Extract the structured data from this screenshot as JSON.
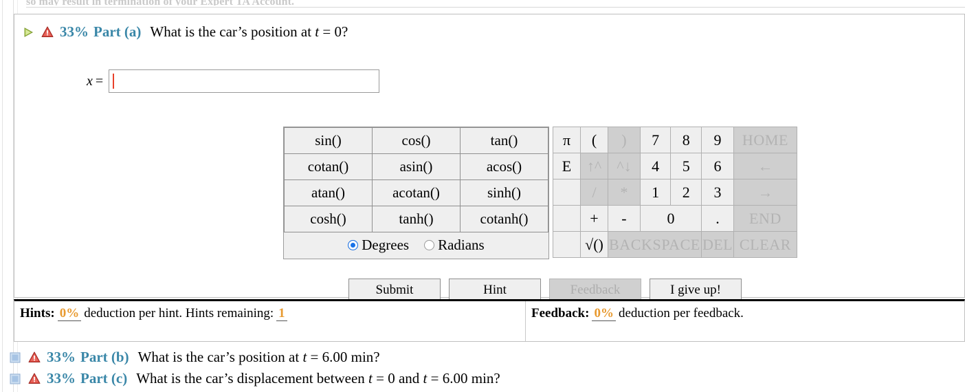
{
  "top_clipped_text": "so may result in termination of your Expert TA Account.",
  "part_a": {
    "icons": {
      "expand": "play-triangle-icon",
      "warning": "warning-triangle-icon"
    },
    "percent": "33%",
    "part_label": "Part (a)",
    "question_prefix": "What is the car’s position at ",
    "question_var": "t",
    "question_suffix": " = 0?",
    "answer": {
      "variable": "x",
      "equals": "=",
      "value": "",
      "placeholder": ""
    }
  },
  "calculator": {
    "functions": [
      [
        "sin()",
        "cos()",
        "tan()"
      ],
      [
        "cotan()",
        "asin()",
        "acos()"
      ],
      [
        "atan()",
        "acotan()",
        "sinh()"
      ],
      [
        "cosh()",
        "tanh()",
        "cotanh()"
      ]
    ],
    "angle_mode": {
      "selected": "Degrees",
      "options": [
        "Degrees",
        "Radians"
      ]
    },
    "keypad": {
      "row1": [
        "π",
        "(",
        ")",
        "7",
        "8",
        "9",
        "HOME"
      ],
      "row2": [
        "E",
        "↑^",
        "^↓",
        "4",
        "5",
        "6",
        "←"
      ],
      "row3": [
        "",
        "/",
        "*",
        "1",
        "2",
        "3",
        "→"
      ],
      "row4": [
        "",
        "+",
        "-",
        "0",
        ".",
        "END"
      ],
      "row5": [
        "",
        "√()",
        "BACKSPACE",
        "DEL",
        "CLEAR"
      ]
    },
    "disabled_keys": [
      ")",
      "↑^",
      "^↓",
      "/",
      "*",
      "HOME",
      "←",
      "→",
      "END",
      "BACKSPACE",
      "DEL",
      "CLEAR"
    ]
  },
  "buttons": {
    "submit": "Submit",
    "hint": "Hint",
    "feedback": "Feedback",
    "give_up": "I give up!",
    "feedback_disabled": true
  },
  "hints_bar": {
    "hints_title": "Hints:",
    "hints_percent": "0%",
    "hints_text_mid": "deduction per hint. Hints remaining:",
    "hints_remaining": "1",
    "feedback_title": "Feedback:",
    "feedback_percent": "0%",
    "feedback_text": "deduction per feedback."
  },
  "part_b": {
    "icon": "collapsed-square-icon",
    "warning_icon": "warning-triangle-icon",
    "percent": "33%",
    "part_label": "Part (b)",
    "question_prefix": "What is the car’s position at ",
    "question_var": "t",
    "question_suffix": " = 6.00 min?"
  },
  "part_c": {
    "icon": "collapsed-square-icon",
    "warning_icon": "warning-triangle-icon",
    "percent": "33%",
    "part_label": "Part (c)",
    "question_prefix": "What is the car’s displacement between ",
    "question_var1": "t",
    "question_mid": " = 0 and ",
    "question_var2": "t",
    "question_suffix": " = 6.00 min?"
  },
  "colors": {
    "accent_blue": "#3a87a8",
    "orange": "#e89a30",
    "caret_red": "#e8402a",
    "key_bg": "#efefef",
    "key_disabled_bg": "#cfcfcf"
  }
}
